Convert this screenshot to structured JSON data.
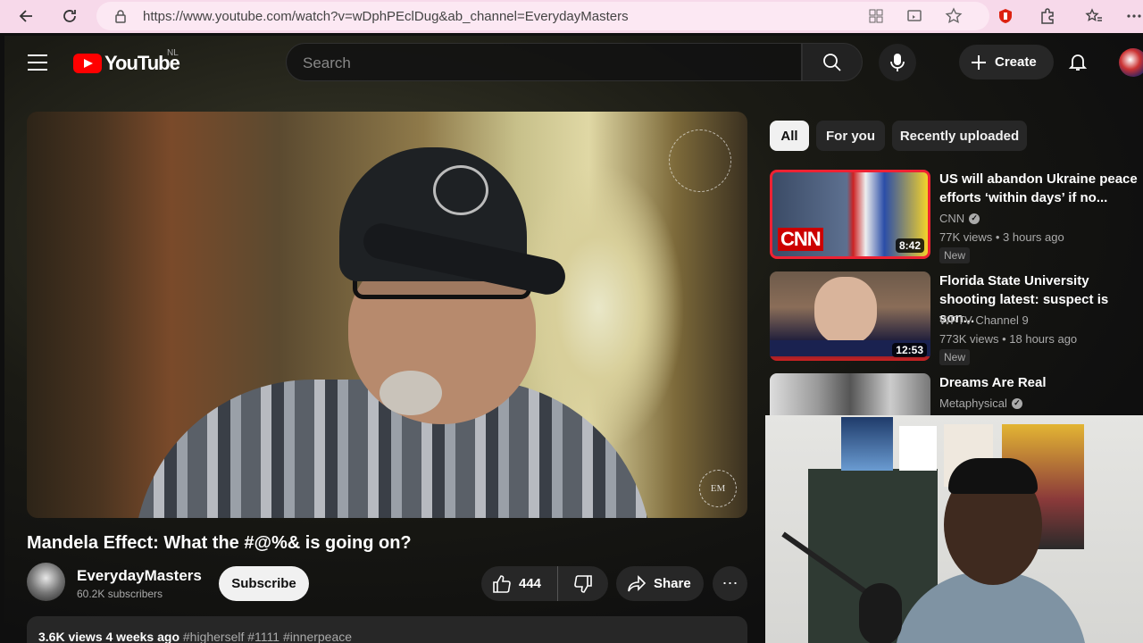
{
  "browser": {
    "url": "https://www.youtube.com/watch?v=wDphPEclDug&ab_channel=EverydayMasters"
  },
  "header": {
    "logo_text": "YouTube",
    "region": "NL",
    "search_placeholder": "Search",
    "create_label": "Create"
  },
  "video": {
    "title": "Mandela Effect: What the #@%& is going on?",
    "watermark": "EM",
    "channel_name": "EverydayMasters",
    "subscribers": "60.2K subscribers",
    "subscribe_label": "Subscribe",
    "likes": "444",
    "share_label": "Share",
    "more_label": "⋯",
    "views": "3.6K views",
    "posted": "4 weeks ago",
    "tags": "#higherself #1111 #innerpeace"
  },
  "chips": [
    {
      "label": "All",
      "active": true
    },
    {
      "label": "For you",
      "active": false
    },
    {
      "label": "Recently uploaded",
      "active": false
    }
  ],
  "recommendations": [
    {
      "title": "US will abandon Ukraine peace efforts ‘within days’ if no...",
      "channel": "CNN",
      "verified": true,
      "views": "77K views",
      "age": "3 hours ago",
      "badge": "New",
      "duration": "8:42",
      "thumb_logo": "CNN"
    },
    {
      "title": "Florida State University shooting latest: suspect is son...",
      "channel": "WFTV Channel 9",
      "verified": false,
      "views": "773K views",
      "age": "18 hours ago",
      "badge": "New",
      "duration": "12:53"
    },
    {
      "title": "Dreams Are Real",
      "channel": "Metaphysical",
      "verified": true
    }
  ],
  "colors": {
    "brand_red": "#ff0000",
    "page_bg": "#0f0f0f",
    "chip_bg": "#272727"
  }
}
